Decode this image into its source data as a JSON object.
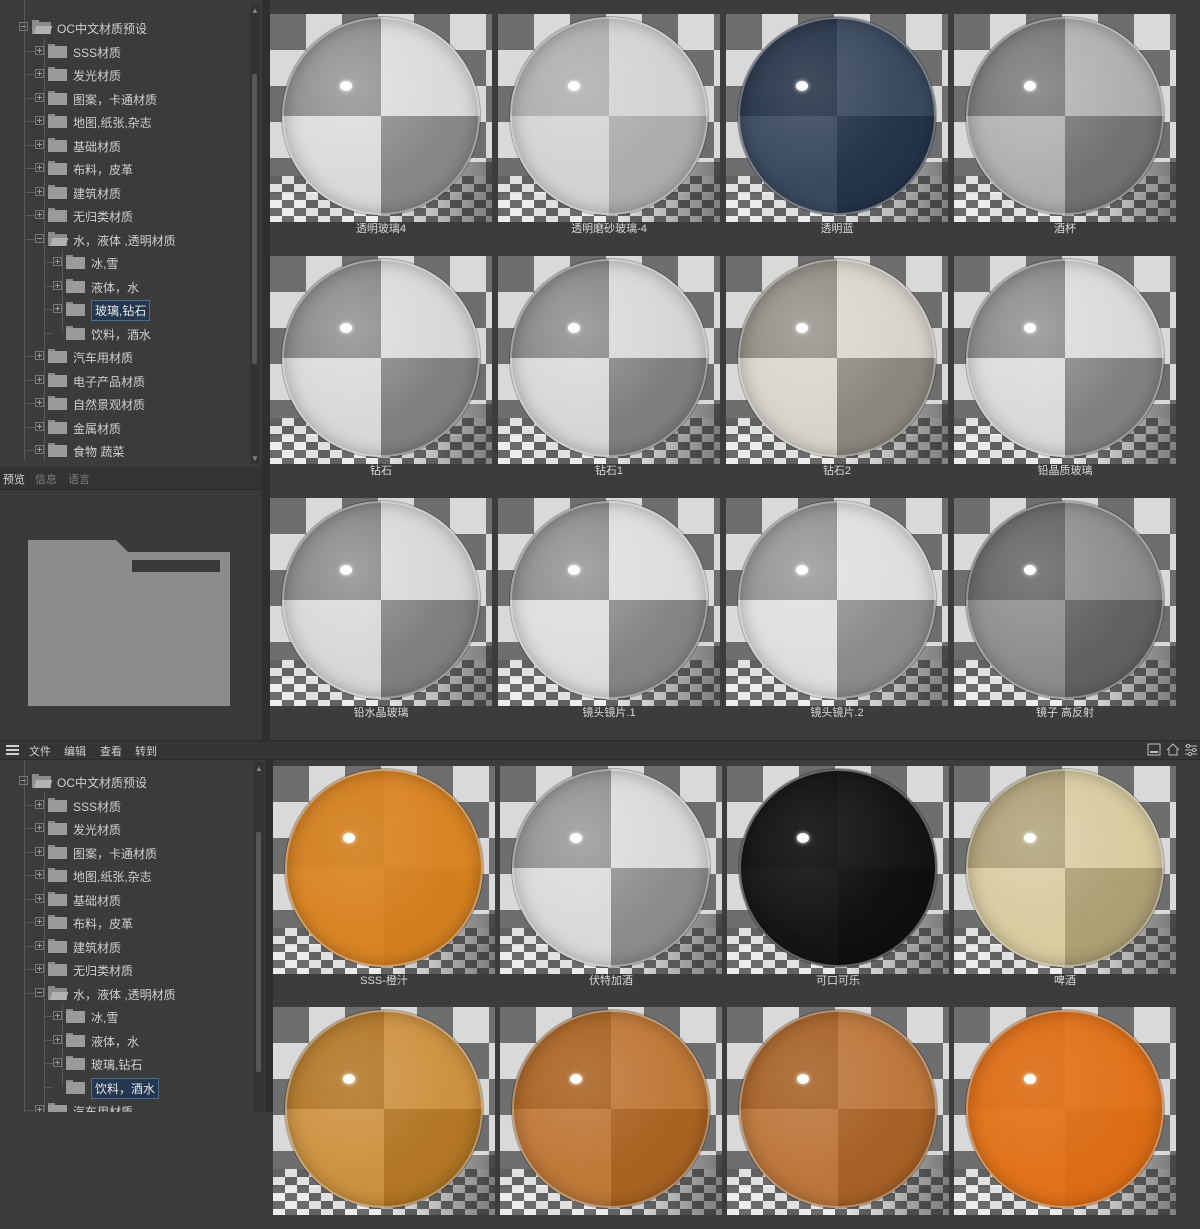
{
  "tree": [
    {
      "label": "OC中文材质预设",
      "type": "open"
    },
    {
      "label": "SSS材质",
      "type": "closed"
    },
    {
      "label": "发光材质",
      "type": "closed"
    },
    {
      "label": "图案，卡通材质",
      "type": "closed"
    },
    {
      "label": "地图,纸张,杂志",
      "type": "closed"
    },
    {
      "label": "基础材质",
      "type": "closed"
    },
    {
      "label": "布料，皮革",
      "type": "closed"
    },
    {
      "label": "建筑材质",
      "type": "closed"
    },
    {
      "label": "无归类材质",
      "type": "closed"
    },
    {
      "label": "水，液体 ,透明材质",
      "type": "open"
    },
    {
      "label": "冰,雪",
      "type": "child"
    },
    {
      "label": "液体，水",
      "type": "child"
    },
    {
      "label": "玻璃,钻石",
      "type": "child"
    },
    {
      "label": "饮料，酒水",
      "type": "child-last"
    },
    {
      "label": "汽车用材质",
      "type": "closed"
    },
    {
      "label": "电子产品材质",
      "type": "closed"
    },
    {
      "label": "自然景观材质",
      "type": "closed"
    },
    {
      "label": "金属材质",
      "type": "closed"
    },
    {
      "label": "食物 蔬菜",
      "type": "closed"
    }
  ],
  "top_selected": "玻璃,钻石",
  "bottom_selected": "饮料，酒水",
  "panel_tabs": {
    "preview": "预览",
    "info": "信息",
    "language": "语言"
  },
  "menu": {
    "file": "文件",
    "edit": "编辑",
    "view": "查看",
    "goto": "转到"
  },
  "icons": {
    "menu": "hamburger-icon",
    "minimize": "minimize-icon",
    "home": "home-icon",
    "settings": "sliders-icon"
  },
  "top_materials": [
    {
      "name": "透明玻璃4",
      "color": "#d9d9d9",
      "alpha": 0.25
    },
    {
      "name": "透明磨砂玻璃-4",
      "color": "#cfcfcf",
      "alpha": 0.65
    },
    {
      "name": "透明蓝",
      "color": "#13253f",
      "alpha": 0.8
    },
    {
      "name": "酒杯",
      "color": "#7a7a7a",
      "alpha": 0.45
    },
    {
      "name": "钻石",
      "color": "#d0d0d0",
      "alpha": 0.2
    },
    {
      "name": "钻石1",
      "color": "#c8c8c8",
      "alpha": 0.2
    },
    {
      "name": "钻石2",
      "color": "#cfc6a8",
      "alpha": 0.3
    },
    {
      "name": "铅晶质玻璃",
      "color": "#d6d6d6",
      "alpha": 0.2
    },
    {
      "name": "铅水晶玻璃",
      "color": "#cccccc",
      "alpha": 0.2
    },
    {
      "name": "镜头镜片.1",
      "color": "#e6e6e6",
      "alpha": 0.2
    },
    {
      "name": "镜头镜片.2",
      "color": "#e8e8e8",
      "alpha": 0.25
    },
    {
      "name": "镜子 高反射",
      "color": "#5a5a5a",
      "alpha": 0.6
    }
  ],
  "bottom_materials": [
    {
      "name": "SSS-橙汁",
      "color": "#d9801a",
      "alpha": 0.95
    },
    {
      "name": "伏特加酒",
      "color": "#d6d6d6",
      "alpha": 0.3
    },
    {
      "name": "可口可乐",
      "color": "#0b0b0b",
      "alpha": 0.95
    },
    {
      "name": "啤酒",
      "color": "#d7c27a",
      "alpha": 0.6
    },
    {
      "name": "",
      "color": "#c97a0d",
      "alpha": 0.75
    },
    {
      "name": "",
      "color": "#b8600f",
      "alpha": 0.8
    },
    {
      "name": "",
      "color": "#b55e14",
      "alpha": 0.8
    },
    {
      "name": "",
      "color": "#e26d10",
      "alpha": 0.95
    }
  ]
}
